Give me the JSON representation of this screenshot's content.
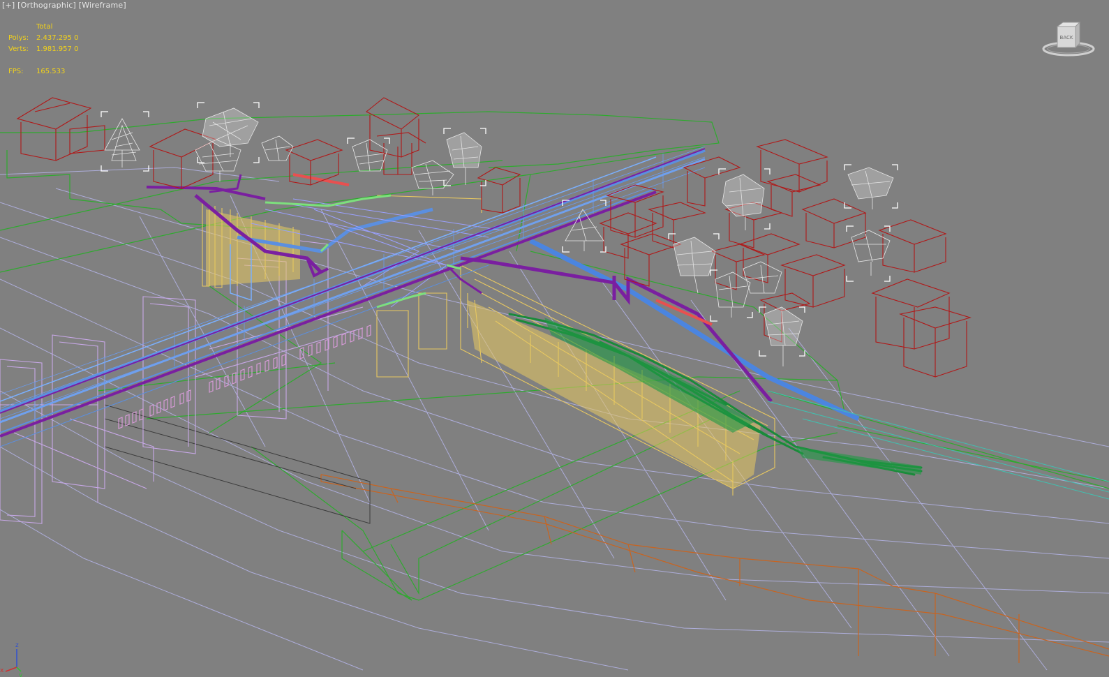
{
  "viewport": {
    "label_plus": "[+]",
    "label_view": "[Orthographic]",
    "label_shading": "[Wireframe]"
  },
  "stats": {
    "total_header": "Total",
    "polys_label": "Polys:",
    "polys_value": "2.437.295",
    "polys_selected": "0",
    "verts_label": "Verts:",
    "verts_value": "1.981.957",
    "verts_selected": "0",
    "fps_label": "FPS:",
    "fps_value": "165.533"
  },
  "viewcube": {
    "face_label": "BACK"
  },
  "axis_tripod": {
    "x": "x",
    "y": "y",
    "z": "z"
  },
  "colors": {
    "background": "#808080",
    "stats_text": "#f2d21a",
    "houses": "#b01818",
    "terrain": "#2eaa2e",
    "bridge_deck": "#5b8fe0",
    "rail": "#7a1fa0",
    "piers": "#e8c860",
    "towers": "#c8a8e8",
    "foliage": "#1a8a3a",
    "road": "#c86420"
  }
}
